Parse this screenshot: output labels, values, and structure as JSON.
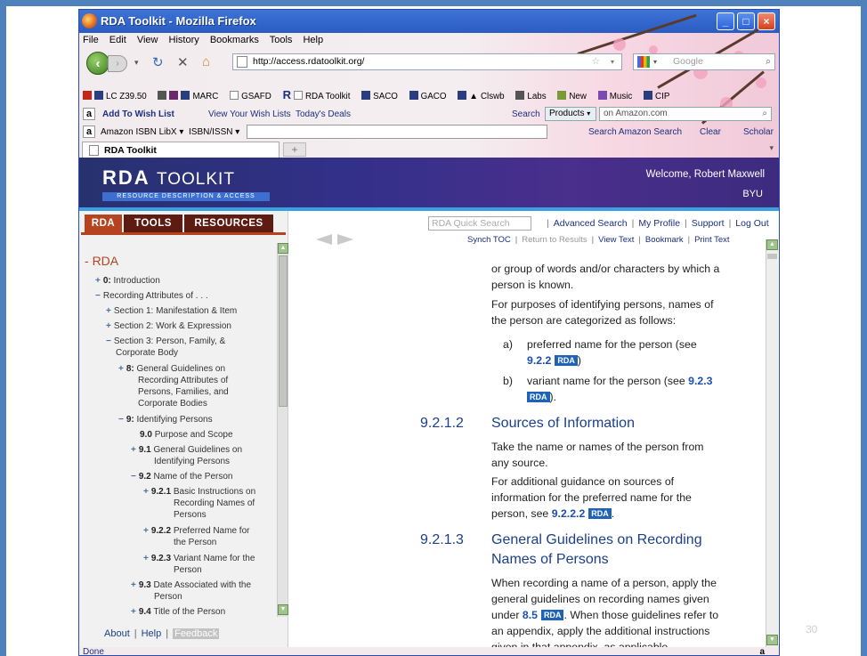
{
  "window": {
    "title": "RDA Toolkit - Mozilla Firefox",
    "controls": {
      "minimize": "_",
      "maximize": "□",
      "close": "×"
    }
  },
  "menubar": [
    "File",
    "Edit",
    "View",
    "History",
    "Bookmarks",
    "Tools",
    "Help"
  ],
  "navbar": {
    "url": "http://access.rdatoolkit.org/",
    "search_placeholder": "Google",
    "back_icon": "back-arrow-icon",
    "reload_icon": "reload-icon",
    "stop_icon": "stop-icon",
    "home_icon": "home-icon"
  },
  "bookmarks": [
    "LC Z39.50",
    "MARC",
    "GSAFD",
    "RDA Toolkit",
    "SACO",
    "GACO",
    "Clswb",
    "Labs",
    "New",
    "Music",
    "CIP"
  ],
  "amazon_bar": {
    "add_wish": "Add To Wish List",
    "your_wish": "View Your Wish Lists",
    "deals": "Today's Deals",
    "search_label": "Search",
    "products": "Products",
    "input_placeholder": "on Amazon.com"
  },
  "libx_bar": {
    "name": "Amazon ISBN LibX",
    "isbn": "ISBN/ISSN",
    "search_amazon": "Search Amazon Search",
    "clear": "Clear",
    "scholar": "Scholar"
  },
  "tab": {
    "label": "RDA Toolkit",
    "new_tab": "+"
  },
  "header": {
    "logo_main": "RDA",
    "logo_toolkit": "TOOLKIT",
    "logo_sub": "RESOURCE DESCRIPTION & ACCESS",
    "welcome": "Welcome, Robert Maxwell",
    "org": "BYU"
  },
  "left_tabs": [
    "RDA",
    "TOOLS",
    "RESOURCES"
  ],
  "tree": {
    "root": "RDA",
    "items": [
      {
        "sign": "+",
        "num": "0:",
        "label": "Introduction"
      },
      {
        "sign": "−",
        "num": "",
        "label": "Recording Attributes of . . ."
      },
      {
        "sign": "+",
        "num": "",
        "label": "Section 1: Manifestation & Item"
      },
      {
        "sign": "+",
        "num": "",
        "label": "Section 2: Work & Expression"
      },
      {
        "sign": "−",
        "num": "",
        "label": "Section 3: Person, Family, &",
        "label2": "Corporate Body"
      },
      {
        "sign": "+",
        "num": "8:",
        "label": "General Guidelines on",
        "label2": "Recording Attributes of",
        "label3": "Persons, Families, and",
        "label4": "Corporate Bodies"
      },
      {
        "sign": "−",
        "num": "9:",
        "label": "Identifying Persons"
      },
      {
        "sign": "",
        "num": "9.0",
        "label": "Purpose and Scope"
      },
      {
        "sign": "+",
        "num": "9.1",
        "label": "General Guidelines on",
        "label2": "Identifying Persons"
      },
      {
        "sign": "−",
        "num": "9.2",
        "label": "Name of the Person"
      },
      {
        "sign": "+",
        "num": "9.2.1",
        "label": "Basic Instructions on",
        "label2": "Recording Names of",
        "label3": "Persons"
      },
      {
        "sign": "+",
        "num": "9.2.2",
        "label": "Preferred Name for",
        "label2": "the Person"
      },
      {
        "sign": "+",
        "num": "9.2.3",
        "label": "Variant Name for the",
        "label2": "Person"
      },
      {
        "sign": "+",
        "num": "9.3",
        "label": "Date Associated with the",
        "label2": "Person"
      },
      {
        "sign": "+",
        "num": "9.4",
        "label": "Title of the Person"
      }
    ]
  },
  "left_footer": {
    "about": "About",
    "help": "Help",
    "feedback": "Feedback"
  },
  "toplinks": {
    "quick_search": "RDA Quick Search",
    "advanced": "Advanced Search",
    "profile": "My Profile",
    "support": "Support",
    "logout": "Log Out"
  },
  "doclinks": {
    "synch": "Synch TOC",
    "return": "Return to Results",
    "view_text": "View Text",
    "bookmark": "Bookmark",
    "print": "Print Text"
  },
  "content": {
    "p1": "or group of words and/or characters by which a",
    "p1b": "person is known.",
    "p2": "For purposes of identifying persons, names of",
    "p2b": "the person are categorized as follows:",
    "a_label": "a)",
    "a_text": "preferred name for the person (see",
    "a_ref": "9.2.2",
    "b_label": "b)",
    "b_text": "variant name for the person (see",
    "b_ref": "9.2.3",
    "rda_tag": "RDA",
    "s1_num": "9.2.1.2",
    "s1_title": "Sources of Information",
    "s1_p1": "Take the name or names of the person from",
    "s1_p1b": "any source.",
    "s1_p2": "For additional guidance on sources of",
    "s1_p2b": "information for the preferred name for the",
    "s1_p2c": "person, see",
    "s1_ref": "9.2.2.2",
    "s2_num": "9.2.1.3",
    "s2_title": "General Guidelines on Recording",
    "s2_title2": "Names of Persons",
    "s2_p1": "When recording a name of a person, apply the",
    "s2_p1b": "general guidelines on recording names given",
    "s2_p1c": "under",
    "s2_ref": "8.5",
    "s2_p1d": ". When those guidelines refer to",
    "s2_p1e": "an appendix, apply the additional instructions",
    "s2_p1f": "given in that appendix, as applicable."
  },
  "status": "Done",
  "slide_number": "30"
}
